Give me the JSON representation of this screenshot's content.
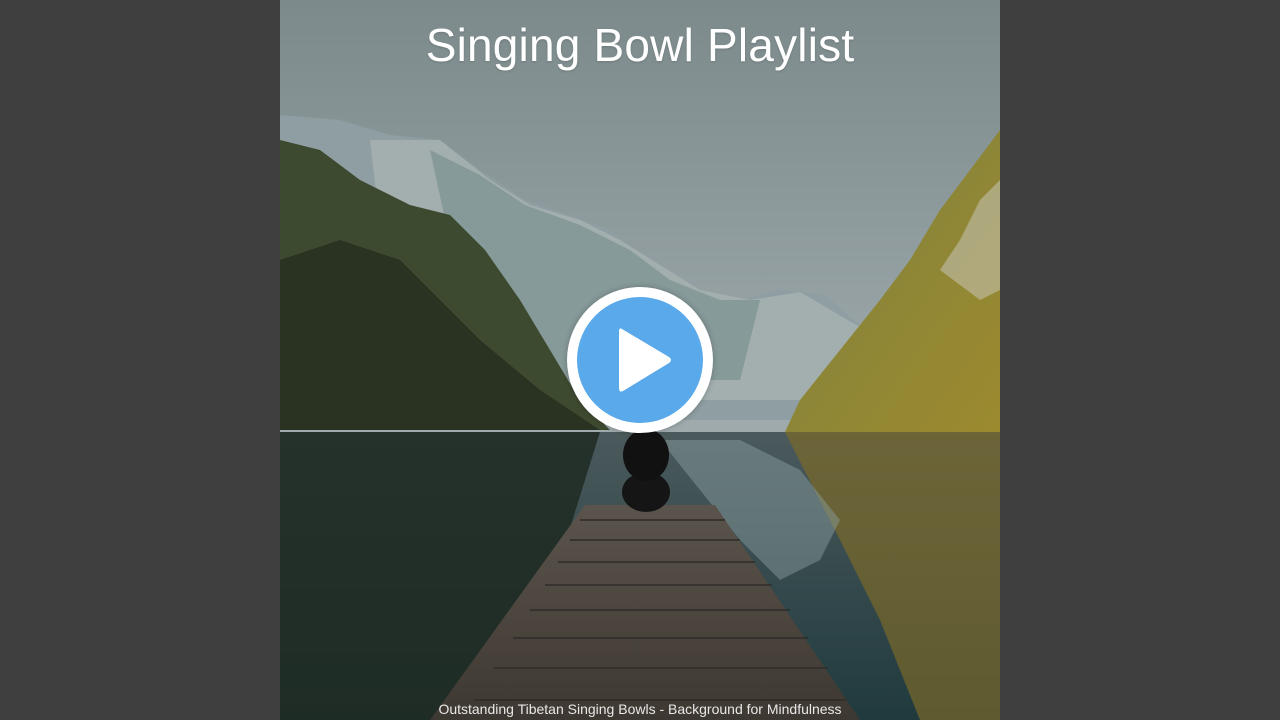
{
  "video": {
    "album_title": "Singing Bowl Playlist",
    "track_title": "Outstanding Tibetan Singing Bowls - Background for Mindfulness",
    "play_icon": "play-icon"
  },
  "colors": {
    "background": "#3f3f3f",
    "play_button_fill": "#5aa9ea",
    "play_button_ring": "#ffffff",
    "text": "#ffffff"
  }
}
